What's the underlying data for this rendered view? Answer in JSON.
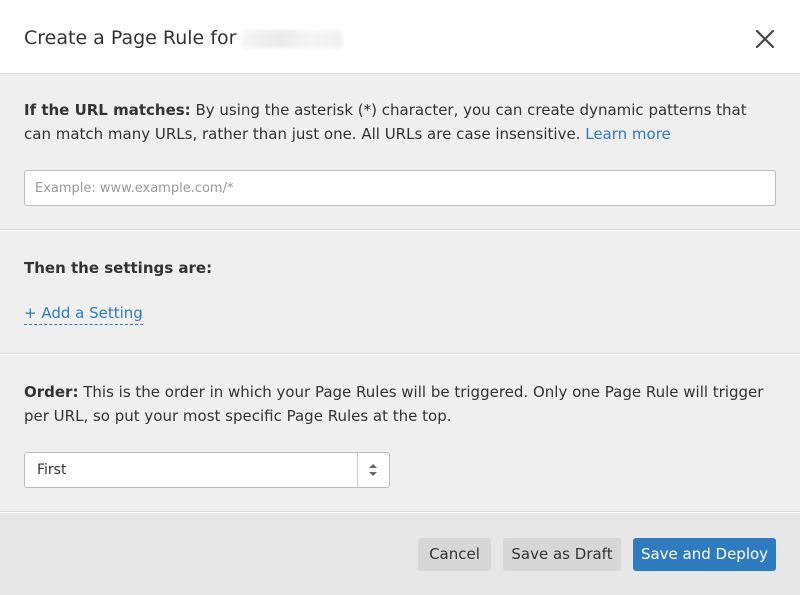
{
  "header": {
    "title": "Create a Page Rule for",
    "close_icon": "close-icon"
  },
  "url_section": {
    "label": "If the URL matches:",
    "description": "By using the asterisk (*) character, you can create dynamic patterns that can match many URLs, rather than just one. All URLs are case insensitive.",
    "learn_more": "Learn more",
    "input_placeholder": "Example: www.example.com/*",
    "input_value": ""
  },
  "settings_section": {
    "heading": "Then the settings are:",
    "add_setting": "+ Add a Setting"
  },
  "order_section": {
    "label": "Order:",
    "description": "This is the order in which your Page Rules will be triggered. Only one Page Rule will trigger per URL, so put your most specific Page Rules at the top.",
    "selected": "First",
    "arrows_icon": "select-arrows-icon"
  },
  "footer": {
    "cancel": "Cancel",
    "save_draft": "Save as Draft",
    "save_deploy": "Save and Deploy"
  },
  "colors": {
    "accent": "#2f7bbf",
    "section_bg": "#eeefee",
    "footer_bg": "#e7e7e7",
    "button_gray": "#d7d7d7"
  }
}
